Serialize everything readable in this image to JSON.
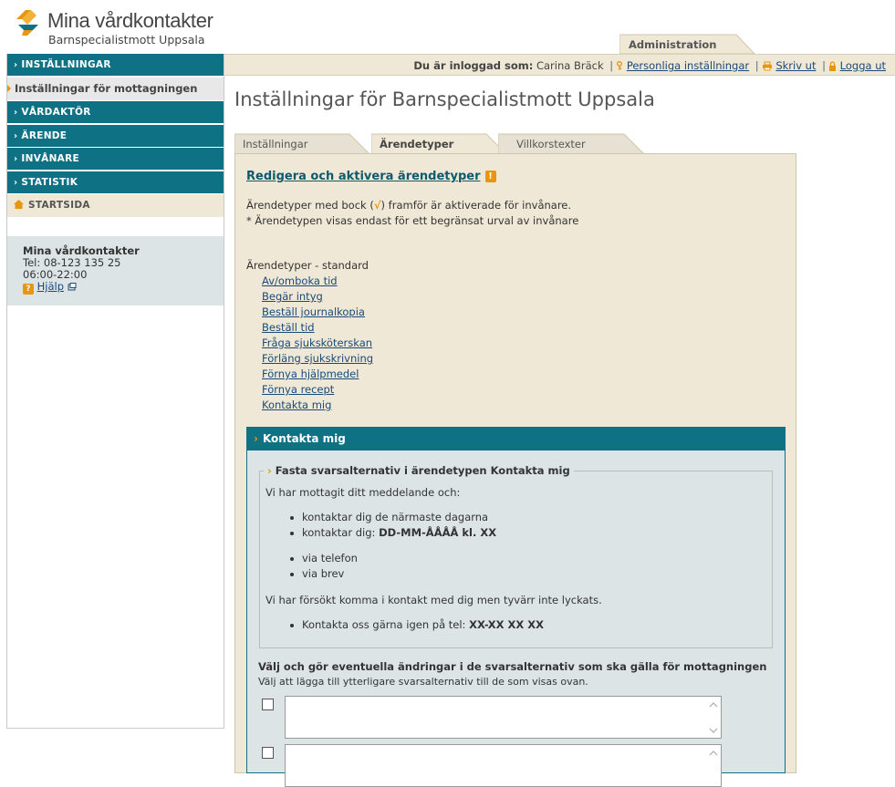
{
  "header": {
    "app_title": "Mina vårdkontakter",
    "clinic_name": "Barnspecialistmott Uppsala",
    "admin_tab": "Administration"
  },
  "topbar": {
    "logged_in_label": "Du är inloggad som:",
    "user_name": "Carina Bräck",
    "personal_settings": "Personliga inställningar",
    "print": "Skriv ut",
    "logout": "Logga ut"
  },
  "sidebar": {
    "items": [
      {
        "label": "INSTÄLLNINGAR"
      },
      {
        "label": "Inställningar för mottagningen"
      },
      {
        "label": "VÅRDAKTÖR"
      },
      {
        "label": "ÄRENDE"
      },
      {
        "label": "INVÅNARE"
      },
      {
        "label": "STATISTIK"
      },
      {
        "label": "STARTSIDA"
      }
    ],
    "contact": {
      "name": "Mina vårdkontakter",
      "phone": "Tel: 08-123 135 25",
      "hours": "06:00-22:00",
      "help": "Hjälp"
    }
  },
  "main": {
    "title": "Inställningar för Barnspecialistmott Uppsala",
    "tabs": [
      {
        "label": "Inställningar"
      },
      {
        "label": "Ärendetyper"
      },
      {
        "label": "Villkorstexter"
      }
    ],
    "section_title": "Redigera och aktivera ärendetyper",
    "info_line1_pre": "Ärendetyper med bock (",
    "info_check": "√",
    "info_line1_post": ") framför är aktiverade för invånare.",
    "info_line2": "* Ärendetypen visas endast för ett begränsat urval av invånare",
    "list_heading": "Ärendetyper - standard",
    "types": [
      "Av/omboka tid",
      "Begär intyg",
      "Beställ journalkopia",
      "Beställ tid",
      "Fråga sjuksköterskan",
      "Förläng sjukskrivning",
      "Förnya hjälpmedel",
      "Förnya recept",
      "Kontakta mig"
    ],
    "kontakta": {
      "header": "Kontakta mig",
      "legend": "Fasta svarsalternativ i ärendetypen Kontakta mig",
      "intro": "Vi har mottagit ditt meddelande och:",
      "bullets_a1": "kontaktar dig de närmaste dagarna",
      "bullets_a2_pre": "kontaktar dig: ",
      "bullets_a2_bold": "DD-MM-ÅÅÅÅ kl. XX",
      "bullets_b1": "via telefon",
      "bullets_b2": "via brev",
      "failed": "Vi har försökt komma i kontakt med dig men tyvärr inte lyckats.",
      "retry_pre": "Kontakta oss gärna igen på tel: ",
      "retry_bold": "XX-XX XX XX",
      "choose_heading": "Välj och gör eventuella ändringar i de svarsalternativ som ska gälla för mottagningen",
      "choose_sub": "Välj att lägga till ytterligare svarsalternativ till de som visas ovan."
    }
  },
  "colors": {
    "teal": "#0f7184",
    "beige": "#efe8d6",
    "orange": "#e8960f",
    "panel_gray": "#dde4e6"
  }
}
